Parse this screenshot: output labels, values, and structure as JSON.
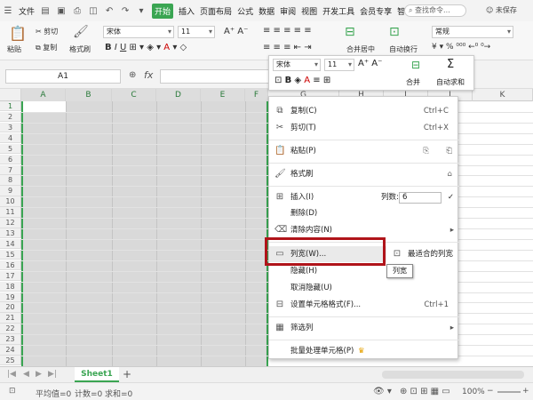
{
  "menubar": {
    "file": "文件",
    "start": "开始",
    "tabs": [
      "插入",
      "页面布局",
      "公式",
      "数据",
      "审阅",
      "视图",
      "开发工具",
      "会员专享",
      "智能工"
    ],
    "search": "查找命令...",
    "unsaved": "未保存"
  },
  "ribbon": {
    "cut": "剪切",
    "copy": "复制",
    "paste": "粘贴",
    "format_painter": "格式刷",
    "font": "宋体",
    "size": "11",
    "merge": "合并居中",
    "wrap": "自动换行",
    "number_format": "常规"
  },
  "formula": {
    "cell": "A1",
    "fx": "fx"
  },
  "columns": [
    "A",
    "B",
    "C",
    "D",
    "E",
    "F",
    "G",
    "H",
    "I",
    "J",
    "K"
  ],
  "rows": [
    "1",
    "2",
    "3",
    "4",
    "5",
    "6",
    "7",
    "8",
    "9",
    "10",
    "11",
    "12",
    "13",
    "14",
    "15",
    "16",
    "17",
    "18",
    "19",
    "20",
    "21",
    "22",
    "23",
    "24",
    "25"
  ],
  "minitb": {
    "font": "宋体",
    "size": "11",
    "merge": "合并",
    "autosum": "自动求和"
  },
  "context_menu": {
    "copy": "复制(C)",
    "copy_sc": "Ctrl+C",
    "cut": "剪切(T)",
    "cut_sc": "Ctrl+X",
    "paste": "粘贴(P)",
    "format_painter": "格式刷",
    "insert": "插入(I)",
    "insert_cols_label": "列数:",
    "insert_cols_value": "6",
    "delete": "删除(D)",
    "clear": "清除内容(N)",
    "col_width": "列宽(W)...",
    "best_fit": "最适合的列宽",
    "hide": "隐藏(H)",
    "unhide": "取消隐藏(U)",
    "format_cells": "设置单元格格式(F)...",
    "format_cells_sc": "Ctrl+1",
    "filter_col": "筛选列",
    "batch": "批量处理单元格(P)"
  },
  "tooltip": "列宽",
  "sheet": {
    "tab": "Sheet1",
    "add": "+"
  },
  "status": {
    "avg": "平均值=0",
    "count": "计数=0",
    "sum": "求和=0",
    "zoom": "100%"
  },
  "colors": {
    "accent": "#3aa552",
    "highlight": "#b0141a"
  }
}
